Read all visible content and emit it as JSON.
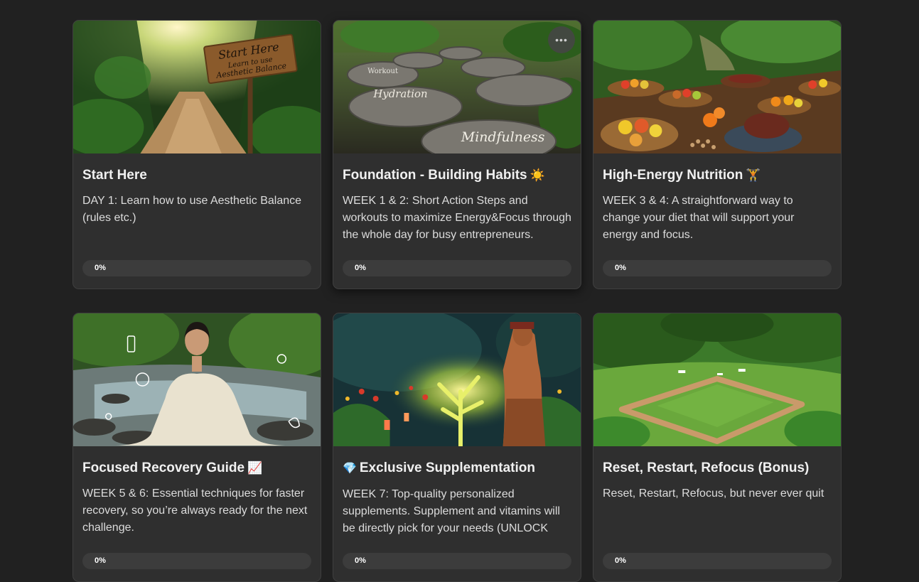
{
  "colors": {
    "background": "#212121",
    "card": "#2f2f2f",
    "progress_track": "#3c3c3c",
    "text": "#e8e8e8"
  },
  "courses": [
    {
      "title": "Start Here",
      "title_emoji": "",
      "title_prefix_emoji": "",
      "description": "DAY 1: Learn how to use Aesthetic Balance (rules etc.)",
      "progress_label": "0%",
      "progress": 0,
      "image_sign_text": [
        "Start Here",
        "Learn to use",
        "Aesthetic Balance"
      ]
    },
    {
      "title": "Foundation - Building Habits",
      "title_emoji": "☀️",
      "title_prefix_emoji": "",
      "description": "WEEK 1 & 2: Short Action Steps and workouts to maximize Energy&Focus through the whole day for busy entrepreneurs.",
      "progress_label": "0%",
      "progress": 0,
      "image_stone_text": [
        "Workout",
        "Hydration",
        "Mindfulness"
      ],
      "menu_icon": "more-horizontal-icon"
    },
    {
      "title": "High-Energy Nutrition",
      "title_emoji": "🏋️",
      "title_prefix_emoji": "",
      "description": "WEEK 3 & 4: A straightforward way to change your diet that will support your energy and focus.",
      "progress_label": "0%",
      "progress": 0
    },
    {
      "title": "Focused Recovery Guide",
      "title_emoji": "📈",
      "title_prefix_emoji": "",
      "description": "WEEK 5 & 6: Essential techniques for faster recovery, so you’re always ready for the next challenge.",
      "progress_label": "0%",
      "progress": 0
    },
    {
      "title": "Exclusive Supplementation",
      "title_emoji": "",
      "title_prefix_emoji": "💎",
      "description": "WEEK 7: Top-quality personalized supplements. Supplement and vitamins will be directly pick for your needs (UNLOCK",
      "progress_label": "0%",
      "progress": 0
    },
    {
      "title": "Reset, Restart, Refocus (Bonus)",
      "title_emoji": "",
      "title_prefix_emoji": "",
      "description": "Reset, Restart, Refocus, but never ever quit",
      "progress_label": "0%",
      "progress": 0
    }
  ]
}
